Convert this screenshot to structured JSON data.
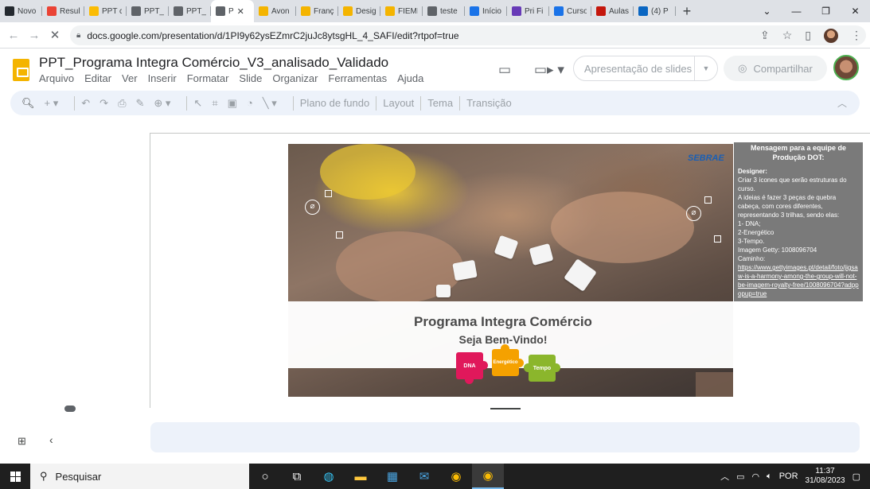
{
  "browser": {
    "tabs": [
      {
        "label": "Novo",
        "icon": "github-icon",
        "color": "#24292f"
      },
      {
        "label": "Resul",
        "icon": "gmail-icon",
        "color": "#ea4335"
      },
      {
        "label": "PPT c",
        "icon": "drive-icon",
        "color": "#fbbc04"
      },
      {
        "label": "PPT_",
        "icon": "link-icon",
        "color": "#5f6368"
      },
      {
        "label": "PPT_",
        "icon": "link-icon",
        "color": "#5f6368"
      },
      {
        "label": "P",
        "icon": "link-icon",
        "color": "#5f6368",
        "active": true
      },
      {
        "label": "Avon",
        "icon": "slides-icon",
        "color": "#f4b400"
      },
      {
        "label": "Franç",
        "icon": "slides-icon",
        "color": "#f4b400"
      },
      {
        "label": "Desig",
        "icon": "slides-icon",
        "color": "#f4b400"
      },
      {
        "label": "FIEMI",
        "icon": "slides-icon",
        "color": "#f4b400"
      },
      {
        "label": "teste",
        "icon": "globe-icon",
        "color": "#5f6368"
      },
      {
        "label": "Início",
        "icon": "edge-icon",
        "color": "#1a73e8"
      },
      {
        "label": "Pri Fi",
        "icon": "forms-icon",
        "color": "#673ab7"
      },
      {
        "label": "Curso",
        "icon": "calendar-icon",
        "color": "#1a73e8"
      },
      {
        "label": "Aulas",
        "icon": "g1-icon",
        "color": "#c4170c"
      },
      {
        "label": "(4) P",
        "icon": "linkedin-icon",
        "color": "#0a66c2"
      }
    ],
    "url": "docs.google.com/presentation/d/1PI9y62ysEZmrC2juJc8ytsgHL_4_SAFI/edit?rtpof=true"
  },
  "docs": {
    "title": "PPT_Programa Integra Comércio_V3_analisado_Validado",
    "menu": [
      "Arquivo",
      "Editar",
      "Ver",
      "Inserir",
      "Formatar",
      "Slide",
      "Organizar",
      "Ferramentas",
      "Ajuda"
    ],
    "present_label": "Apresentação de slides",
    "share_label": "Compartilhar",
    "toolbar": {
      "background": "Plano de fundo",
      "layout": "Layout",
      "theme": "Tema",
      "transition": "Transição"
    }
  },
  "slide": {
    "title": "Programa Integra Comércio",
    "subtitle": "Seja Bem-Vindo!",
    "brand": "SEBRAE",
    "pieces": {
      "dna": "DNA",
      "energy": "Energético",
      "time": "Tempo"
    },
    "colors": {
      "dna": "#e0185b",
      "energy": "#f5a100",
      "time": "#8bb62c"
    }
  },
  "note": {
    "title": "Mensagem para a equipe de Produção DOT:",
    "heading": "Designer:",
    "lines": [
      "Criar 3 ícones que serão estruturas do curso.",
      "A ideias é fazer 3 peças de quebra cabeça, com cores diferentes, representando 3 trilhas, sendo elas:",
      "1- DNA;",
      "2-Energético",
      "3-Tempo.",
      "Imagem Getty: 1008096704",
      "Caminho:"
    ],
    "link": "https://www.gettyimages.pt/detail/foto/jigsaw-is-a-harmony-among-the-group-will-not-be-imagem-royalty-free/1008096704?adppopup=true"
  },
  "taskbar": {
    "search": "Pesquisar",
    "lang": "POR",
    "time": "11:37",
    "date": "31/08/2023"
  }
}
